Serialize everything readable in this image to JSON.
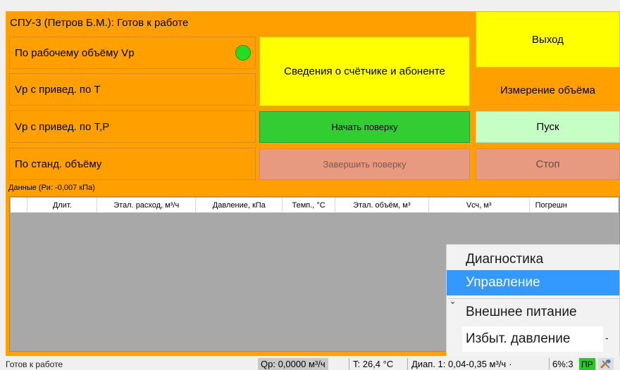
{
  "header": {
    "title": "СПУ-3 (Петров Б.М.): Готов к работе"
  },
  "left_buttons": [
    {
      "label": "По рабочему объёму Vр"
    },
    {
      "label": "Vр с привед. по Т"
    },
    {
      "label": "Vр с привед. по Т,Р"
    },
    {
      "label": "По станд. объёму"
    }
  ],
  "indicator_color": "#22dd22",
  "middle": {
    "meter_info_label": "Сведения о счётчике и абоненте",
    "start_verification_label": "Начать поверку",
    "finish_verification_label": "Завершить поверку"
  },
  "right": {
    "exit_label": "Выход",
    "volume_measure_label": "Измерение объёма",
    "start_label": "Пуск",
    "stop_label": "Стоп"
  },
  "data_section": {
    "label": "Данные (Ри: -0,007 кПа)",
    "columns": [
      "Длит.",
      "Этал. расход, м³/ч",
      "Давление, кПа",
      "Темп., °С",
      "Этал. объём, м³",
      "Vсч, м³",
      "Погрешн"
    ]
  },
  "context_menu": {
    "items": [
      {
        "label": "Диагностика",
        "checked": false
      },
      {
        "label": "Управление",
        "checked": false,
        "highlighted": true
      },
      {
        "label": "Внешнее питание",
        "checked": true
      },
      {
        "label": "Избыт. давление",
        "checked": false
      }
    ],
    "check_glyph": "ˇ",
    "dropdown_glyph": "-"
  },
  "status_bar": {
    "status_text": "Готов к работе",
    "flow": "Qp: 0,0000 м³/ч",
    "temperature": "T: 26,4 °C",
    "range": "Диап. 1: 0,04-0,35 м³/ч",
    "range_arrow": "·",
    "percent": "6%:3",
    "mode_badge": "ПР"
  },
  "colors": {
    "orange": "#ffa000",
    "yellow": "#ffff00",
    "green": "#33cc33",
    "light_green": "#c6ffc6",
    "salmon": "#e89a80",
    "menu_highlight": "#3399ff"
  }
}
